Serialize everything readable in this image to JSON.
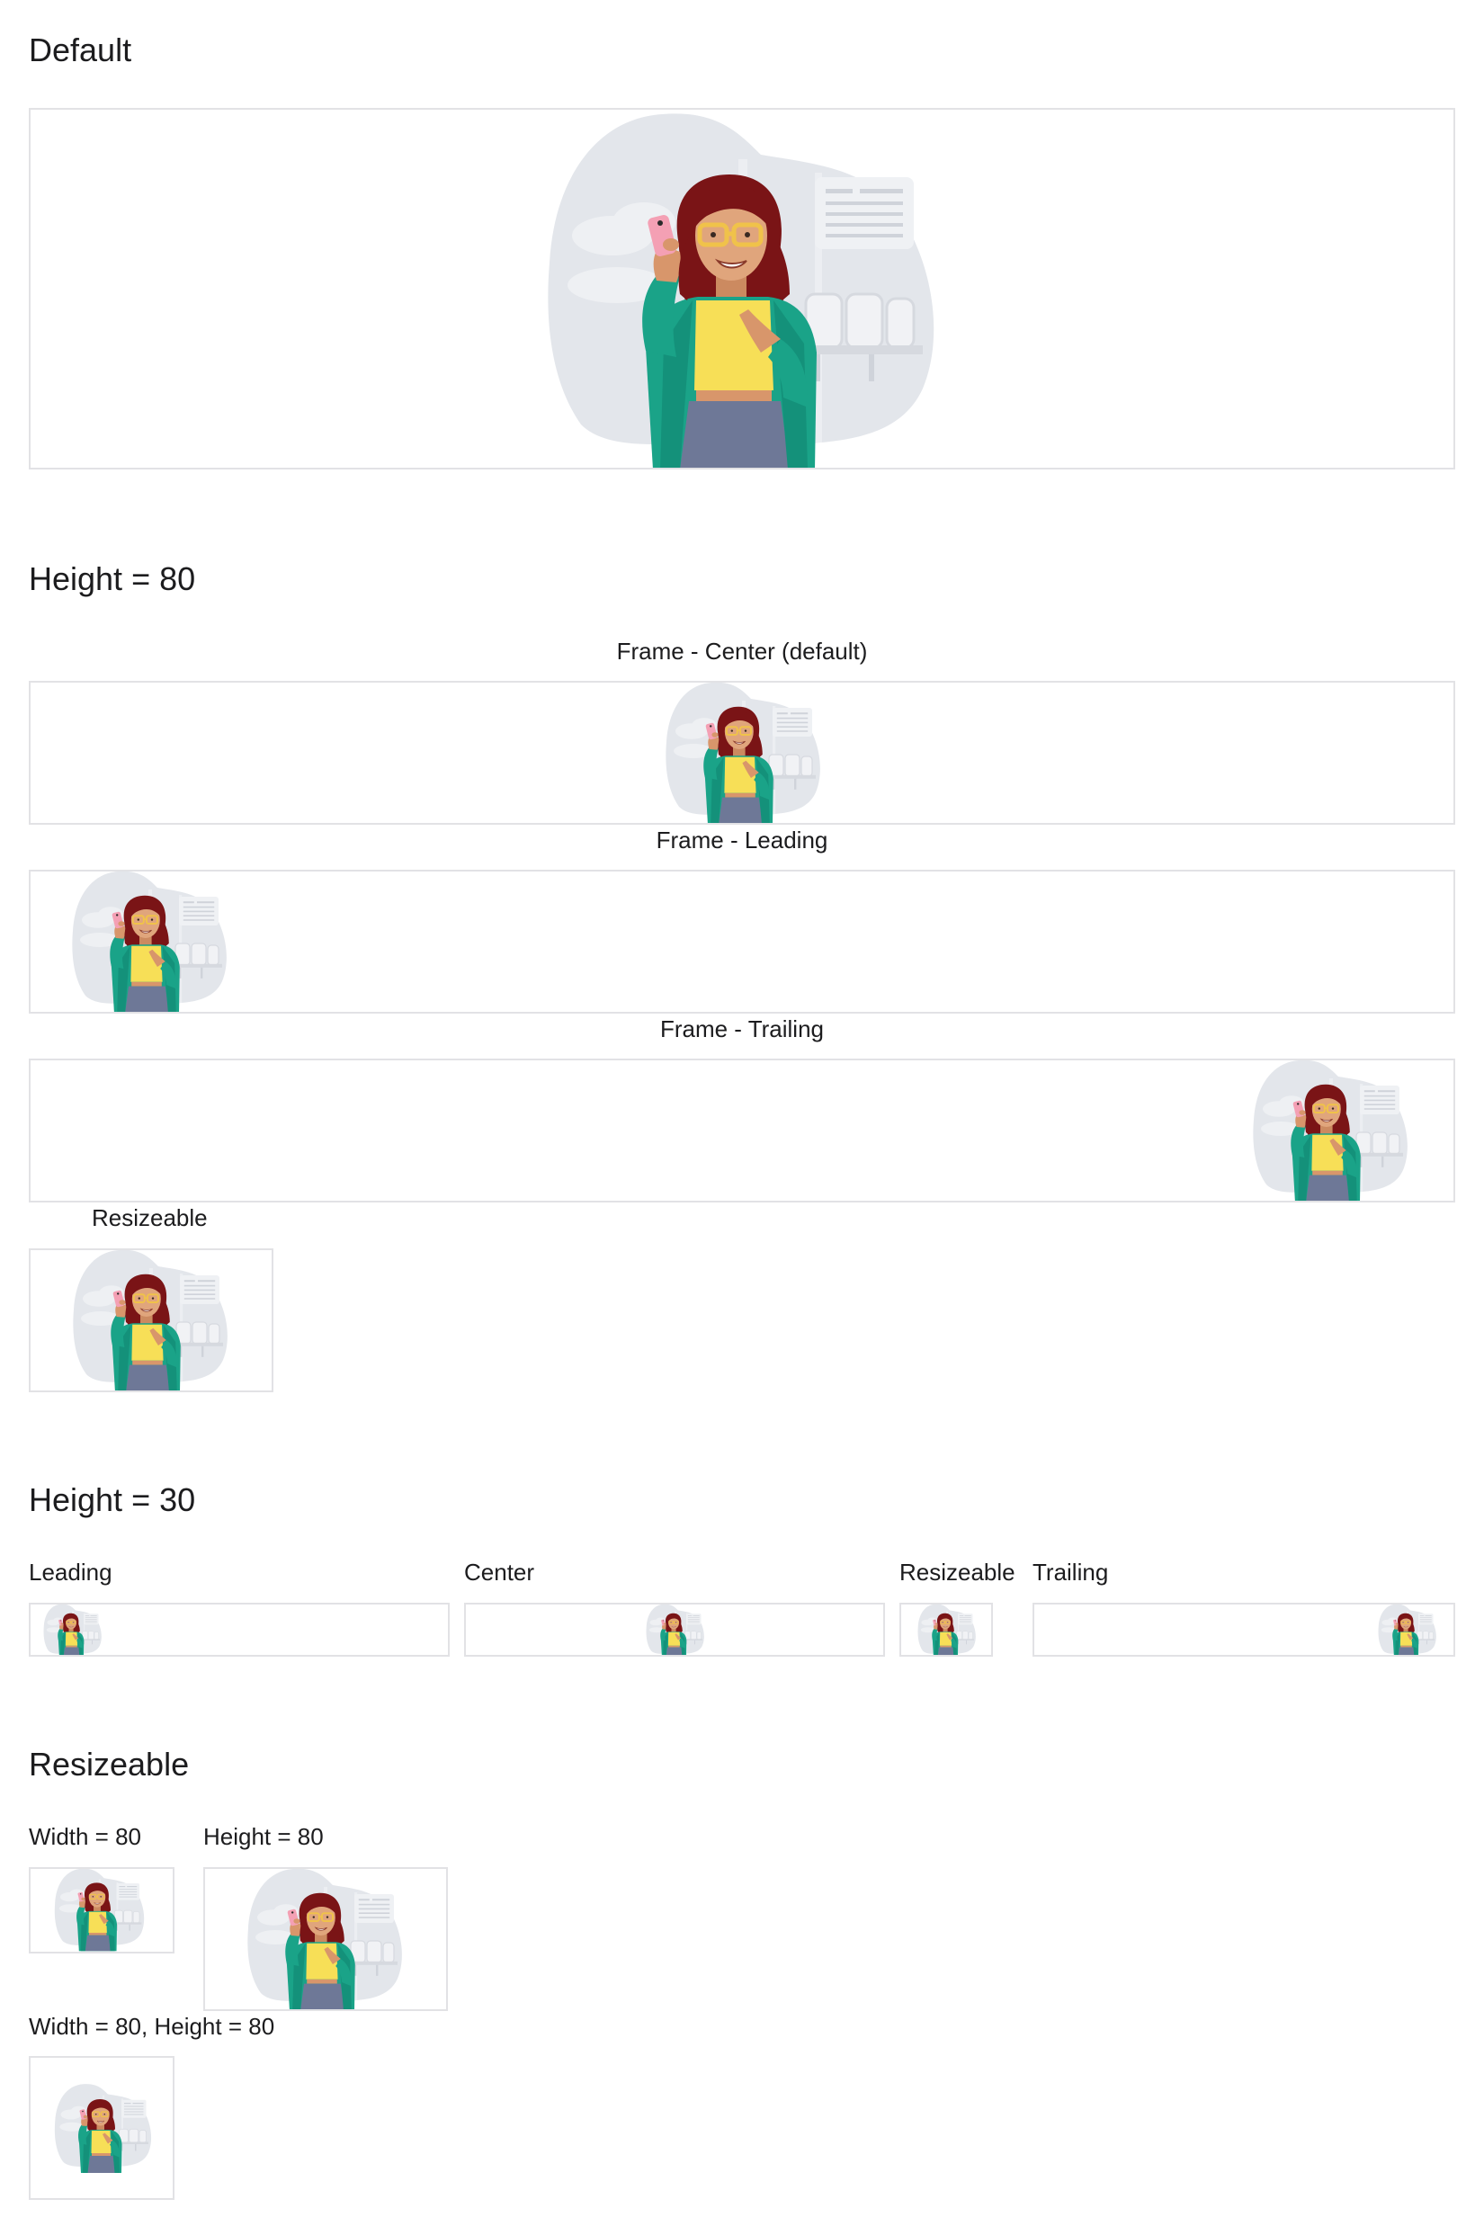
{
  "illustration": {
    "name": "woman-with-phone-illustration",
    "icon": "person-holding-phone-illustration"
  },
  "colors": {
    "frame_border": "#e2e2e5",
    "blob": "#dfe2e8",
    "hair": "#7a1416",
    "jacket": "#1aa388",
    "shirt": "#f7df57",
    "skin": "#d8966b",
    "glasses": "#f0c24a",
    "phone": "#f4a0b4",
    "pants": "#6e7897"
  },
  "sections": {
    "default": {
      "title": "Default"
    },
    "height80": {
      "title": "Height = 80",
      "center_label": "Frame - Center (default)",
      "leading_label": "Frame - Leading",
      "trailing_label": "Frame - Trailing",
      "resizeable_label": "Resizeable"
    },
    "height30": {
      "title": "Height = 30",
      "leading_label": "Leading",
      "center_label": "Center",
      "resizeable_label": "Resizeable",
      "trailing_label": "Trailing"
    },
    "resizeable": {
      "title": "Resizeable",
      "width80_label": "Width = 80",
      "height80_label": "Height = 80",
      "both_label": "Width = 80, Height = 80"
    }
  }
}
